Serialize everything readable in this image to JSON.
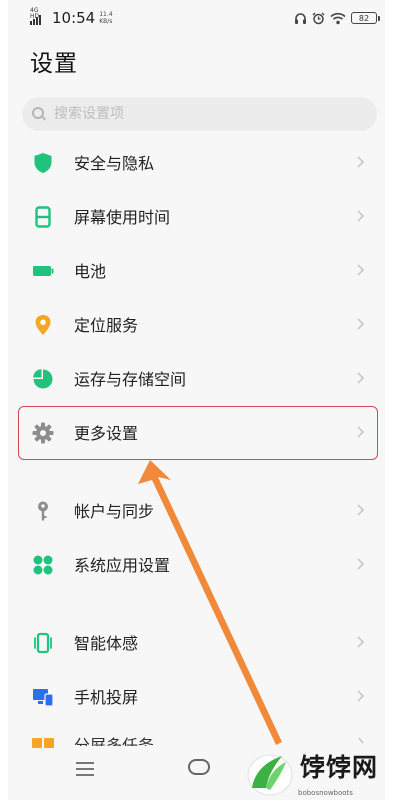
{
  "status_bar": {
    "network_label": "4G HD",
    "time": "10:54",
    "net_speed_value": "11.4",
    "net_speed_unit": "KB/s",
    "battery": "82"
  },
  "header": {
    "title": "设置"
  },
  "search": {
    "placeholder": "搜索设置项"
  },
  "menu": {
    "items": [
      {
        "label": "安全与隐私",
        "icon": "shield-icon",
        "color": "#1fc37d"
      },
      {
        "label": "屏幕使用时间",
        "icon": "hourglass-icon",
        "color": "#1fc37d"
      },
      {
        "label": "电池",
        "icon": "battery-icon",
        "color": "#1fc37d"
      },
      {
        "label": "定位服务",
        "icon": "location-pin-icon",
        "color": "#f5a623"
      },
      {
        "label": "运存与存储空间",
        "icon": "pie-chart-icon",
        "color": "#1fc37d"
      },
      {
        "label": "更多设置",
        "icon": "gear-icon",
        "color": "#8d8d8d"
      },
      {
        "label": "帐户与同步",
        "icon": "key-icon",
        "color": "#8d8d8d"
      },
      {
        "label": "系统应用设置",
        "icon": "app-grid-icon",
        "color": "#1fc37d"
      },
      {
        "label": "智能体感",
        "icon": "phone-motion-icon",
        "color": "#1fc37d"
      },
      {
        "label": "手机投屏",
        "icon": "screen-cast-icon",
        "color": "#2b6ef2"
      },
      {
        "label": "分屏多任务",
        "icon": "split-screen-icon",
        "color": "#f5a623"
      }
    ]
  },
  "annotation": {
    "highlight_color": "#d14a5c",
    "arrow_color": "#f08a3a"
  },
  "watermark": {
    "text": "饽饽网",
    "url": "bobosnowboots"
  }
}
